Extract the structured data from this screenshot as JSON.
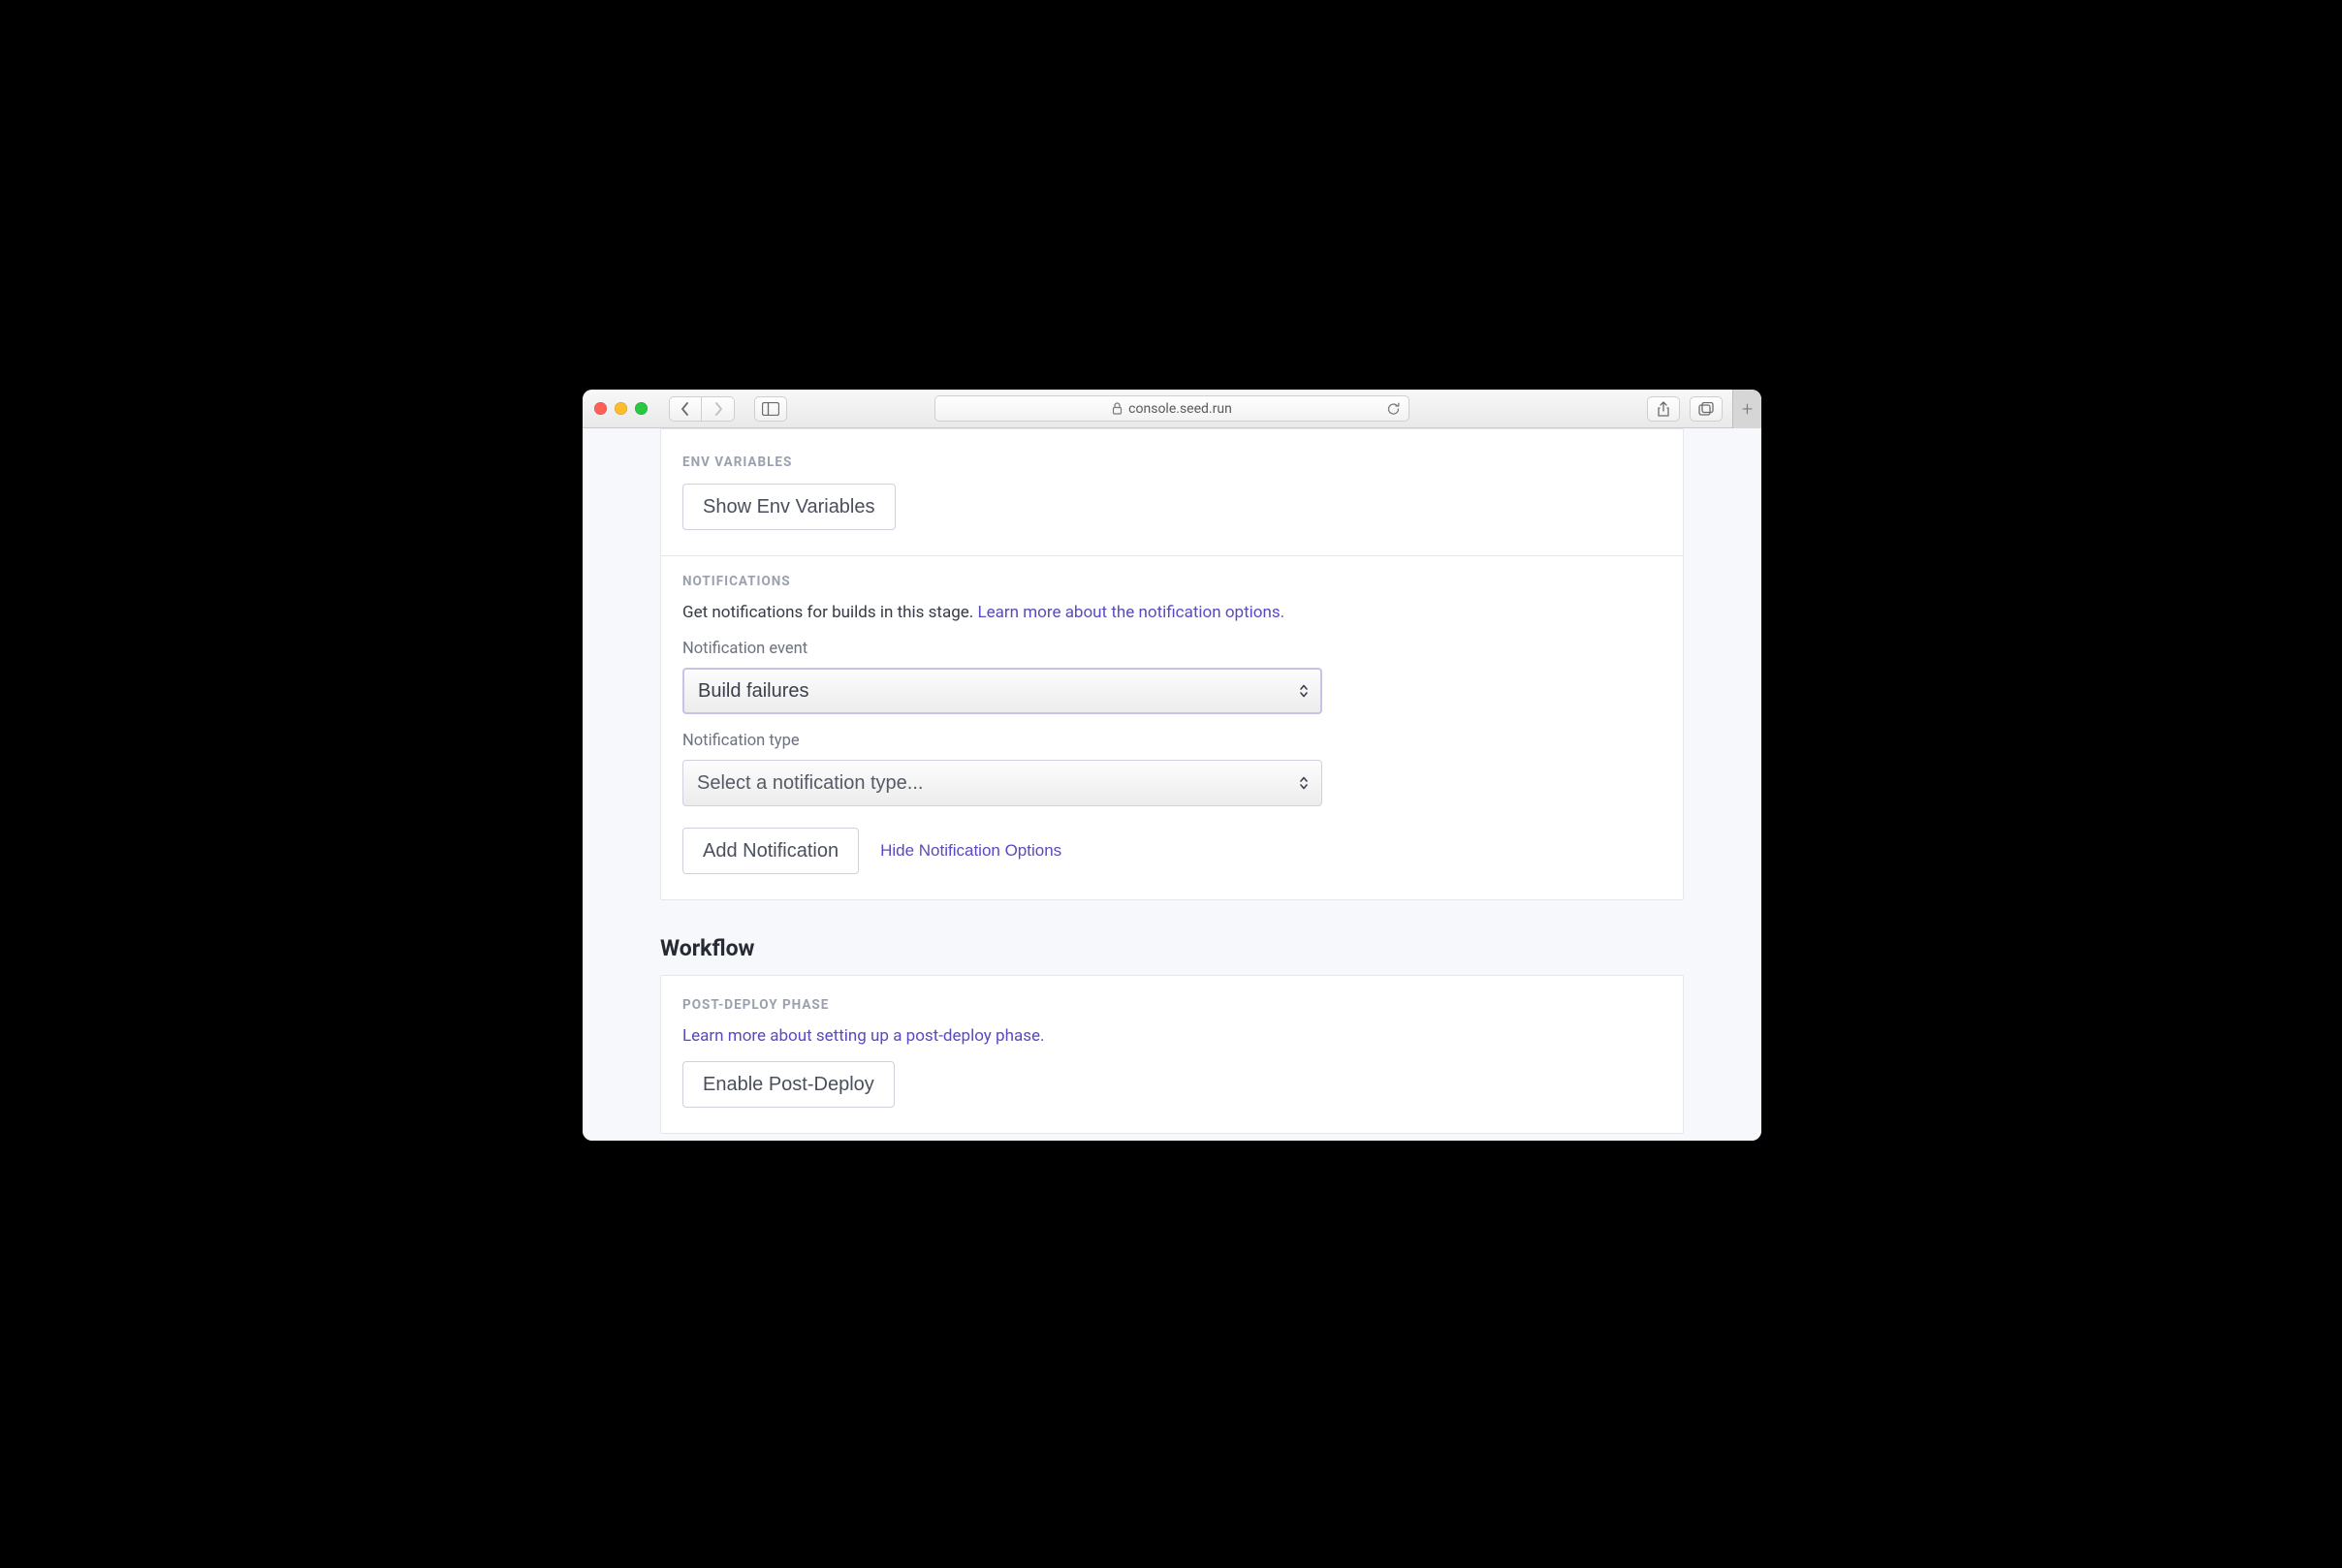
{
  "browser": {
    "url_host": "console.seed.run"
  },
  "env": {
    "heading": "ENV VARIABLES",
    "show_btn": "Show Env Variables"
  },
  "notifications": {
    "heading": "NOTIFICATIONS",
    "desc": "Get notifications for builds in this stage. ",
    "learn_more": "Learn more about the notification options.",
    "event_label": "Notification event",
    "event_value": "Build failures",
    "type_label": "Notification type",
    "type_placeholder": "Select a notification type...",
    "add_btn": "Add Notification",
    "hide_link": "Hide Notification Options"
  },
  "workflow": {
    "title": "Workflow",
    "postdeploy_heading": "POST-DEPLOY PHASE",
    "postdeploy_learn": "Learn more about setting up a post-deploy phase.",
    "enable_btn": "Enable Post-Deploy"
  }
}
